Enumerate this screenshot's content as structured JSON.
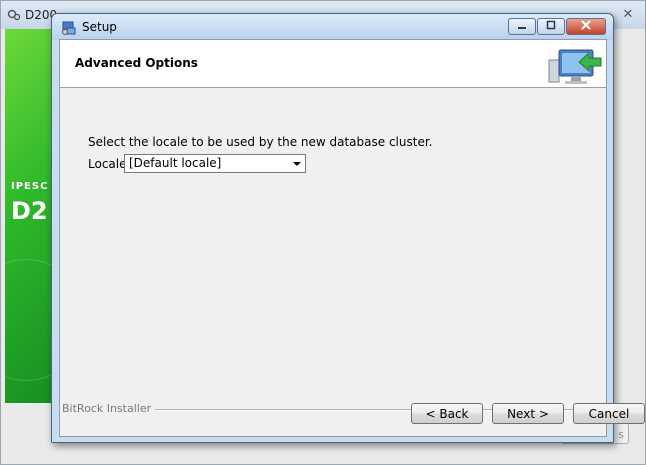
{
  "background_window": {
    "title": "D200",
    "brand_text": "IPESC",
    "brand_big": "D2",
    "close_glyph": "✕",
    "icons": {
      "app": "gear-icon",
      "close": "close-icon"
    }
  },
  "dialog": {
    "title": "Setup",
    "caption_buttons": {
      "minimize": "minimize-icon",
      "maximize": "maximize-icon",
      "close": "close-icon"
    },
    "header": {
      "title": "Advanced Options",
      "graphic": "computer-install-icon"
    },
    "body": {
      "instruction": "Select the locale to be used by the new database cluster.",
      "locale_label": "Locale",
      "locale_value": "[Default locale]"
    },
    "footer": {
      "brand": "BitRock Installer",
      "buttons": {
        "back": "< Back",
        "next": "Next >",
        "cancel": "Cancel"
      }
    }
  },
  "colors": {
    "accent_green": "#2eb82a",
    "close_red": "#c3412b",
    "dialog_frame": "#c8dcf0"
  }
}
